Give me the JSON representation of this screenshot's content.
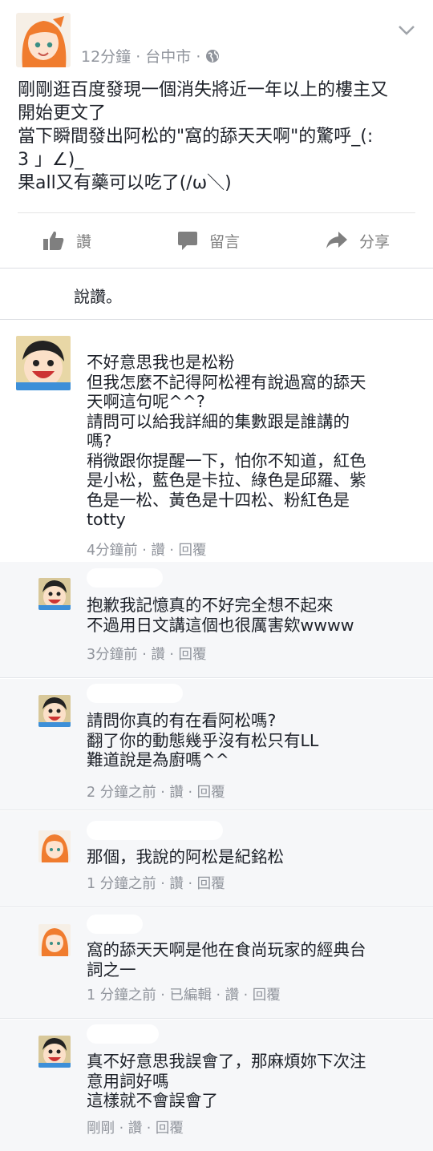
{
  "post": {
    "meta": "12分鐘 · 台中市 · ",
    "text": "剛剛逛百度發現一個消失將近一年以上的樓主又\n開始更文了\n當下瞬間發出阿松的\"窩的舔天天啊\"的驚呼_(:\n3 」∠)_\n果all又有藥可以吃了(/ω＼)",
    "actions": {
      "like": "讚",
      "comment": "留言",
      "share": "分享"
    }
  },
  "likes_line": "說讚。",
  "comments": [
    {
      "text": "不好意思我也是松粉\n但我怎麼不記得阿松裡有說過窩的舔天\n天啊這句呢^^?\n請問可以給我詳細的集數跟是誰講的\n嗎?\n稍微跟你提醒一下，怕你不知道，紅色\n是小松，藍色是卡拉、綠色是邱羅、紫\n色是一松、黃色是十四松、粉紅色是\ntotty",
      "meta": "4分鐘前 · 讚 · 回覆"
    },
    {
      "text": "抱歉我記憶真的不好完全想不起來\n不過用日文講這個也很厲害欸wwww",
      "meta": "3分鐘前 · 讚 · 回覆"
    },
    {
      "text": "請問你真的有在看阿松嗎?\n翻了你的動態幾乎沒有松只有LL\n難道說是為廚嗎^^",
      "meta": "2 分鐘之前 · 讚 · 回覆"
    },
    {
      "text": "那個，我說的阿松是紀銘松",
      "meta": "1 分鐘之前 · 讚 · 回覆"
    },
    {
      "text": "窩的舔天天啊是他在食尚玩家的經典台\n詞之一",
      "meta": "1 分鐘之前 · 已編輯 · 讚 · 回覆"
    },
    {
      "text": "真不好意思我誤會了，那麻煩妳下次注\n意用詞好嗎\n這樣就不會誤會了",
      "meta": "剛剛 · 讚 · 回覆"
    }
  ],
  "colors": {
    "meta_gray": "#90949c",
    "icon_gray": "#7f7f7f",
    "reply_bg": "#f6f7f9",
    "text": "#1d2129"
  },
  "icons": [
    "chevron-down-icon",
    "globe-icon",
    "thumbs-up-icon",
    "comment-icon",
    "share-icon"
  ]
}
